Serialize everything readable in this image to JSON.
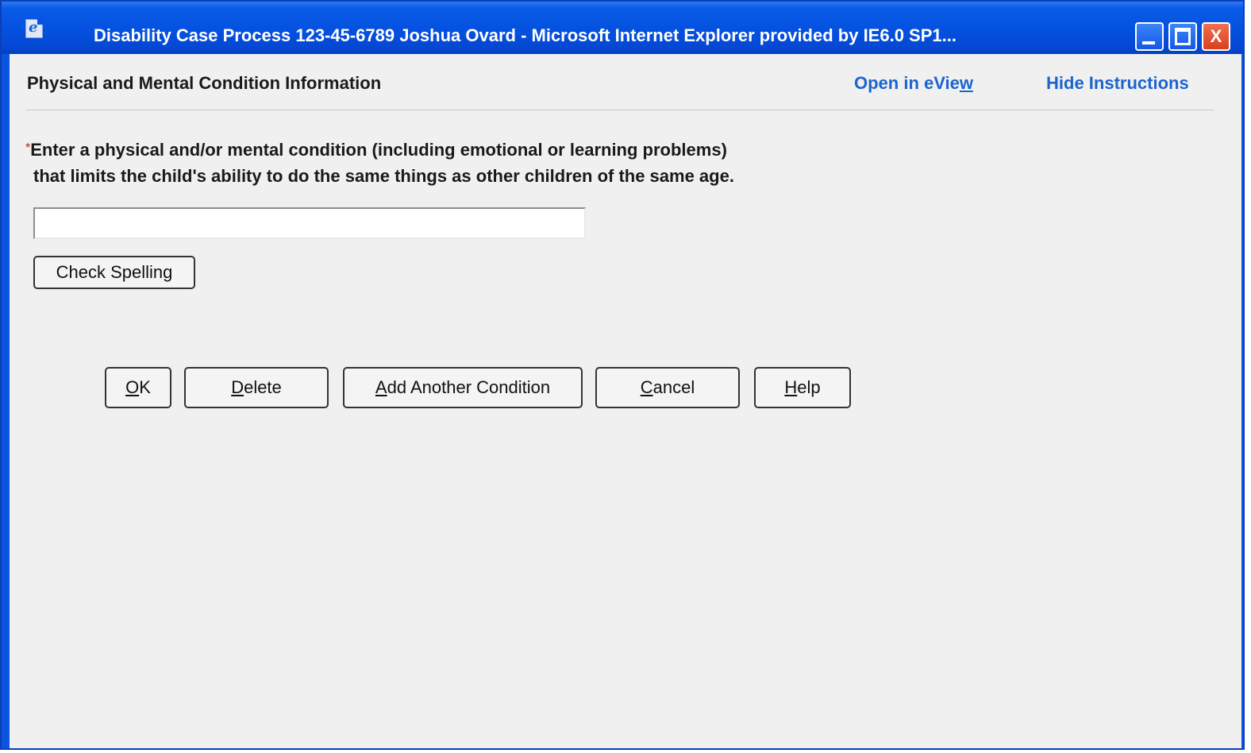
{
  "window": {
    "title": "Disability Case Process 123-45-6789 Joshua Ovard  -  Microsoft Internet Explorer provided by IE6.0 SP1...",
    "close_glyph": "X",
    "app_icon": "ie-page-icon",
    "colors": {
      "titlebar": "#0552e0",
      "client_background": "#f0f0f0",
      "link": "#1b64d0",
      "required_marker": "#b02020"
    }
  },
  "header": {
    "page_title": "Physical and Mental Condition Information",
    "links": {
      "eview_prefix": "Open in eVie",
      "eview_accesskey": "w",
      "hide_instructions": "Hide Instructions"
    }
  },
  "form": {
    "required_marker": "*",
    "instruction_line1": "Enter a physical and/or mental condition (including emotional or learning problems)",
    "instruction_line2": "that limits the child's ability to do the same things as other children of the same age.",
    "condition_input": {
      "value": "",
      "placeholder": ""
    },
    "check_spelling_label": "Check Spelling"
  },
  "actions": {
    "ok": {
      "accesskey": "O",
      "rest": "K"
    },
    "delete": {
      "accesskey": "D",
      "rest": "elete"
    },
    "add_another": {
      "accesskey": "A",
      "rest": "dd Another Condition"
    },
    "cancel": {
      "accesskey": "C",
      "rest": "ancel"
    },
    "help": {
      "accesskey": "H",
      "rest": "elp"
    }
  }
}
